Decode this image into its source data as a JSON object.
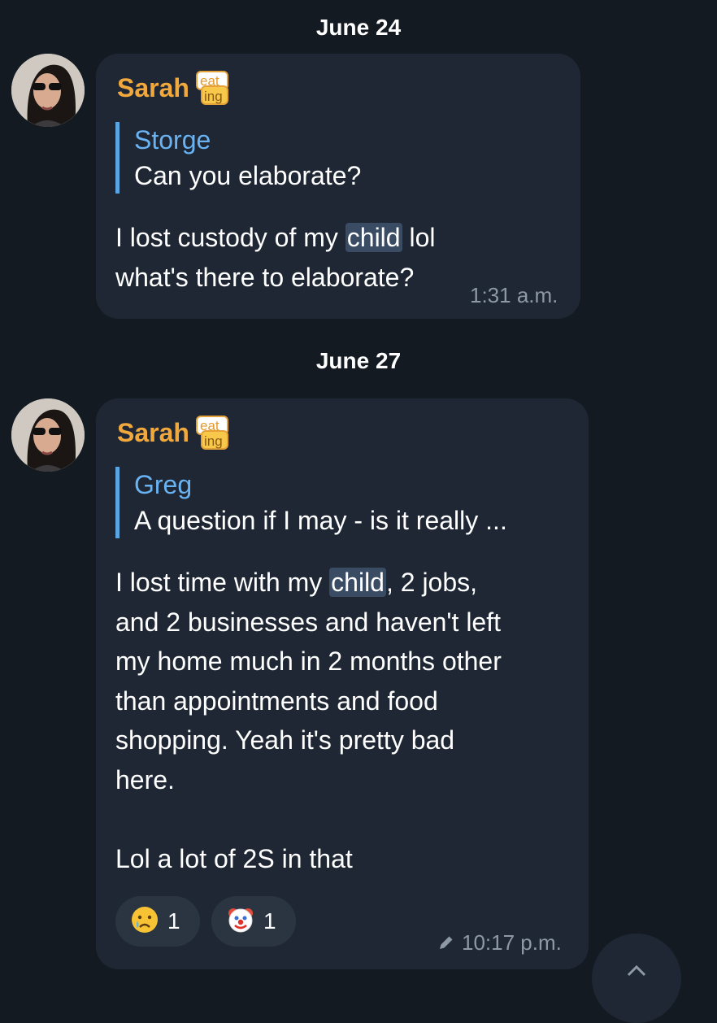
{
  "messages": [
    {
      "date": "June 24",
      "sender": "Sarah",
      "sticker_text": [
        "eat",
        "ing"
      ],
      "reply_to": {
        "name": "Storge",
        "text": "Can you elaborate?"
      },
      "body_lines": [
        {
          "pre": "I lost custody of my ",
          "hl": "child",
          "post": " lol"
        },
        {
          "pre": "what's there to elaborate?",
          "hl": "",
          "post": ""
        }
      ],
      "time": "1:31 a.m."
    },
    {
      "date": "June 27",
      "sender": "Sarah",
      "sticker_text": [
        "eat",
        "ing"
      ],
      "reply_to": {
        "name": "Greg",
        "text": "A question if I may - is it really ..."
      },
      "body_lines": [
        {
          "pre": "I lost time with my ",
          "hl": "child",
          "post": ", 2 jobs,"
        },
        {
          "pre": "and 2 businesses and haven't left",
          "hl": "",
          "post": ""
        },
        {
          "pre": "my home much in 2 months other",
          "hl": "",
          "post": ""
        },
        {
          "pre": "than appointments and food",
          "hl": "",
          "post": ""
        },
        {
          "pre": "shopping. Yeah it's pretty bad",
          "hl": "",
          "post": ""
        },
        {
          "pre": "here.",
          "hl": "",
          "post": ""
        },
        {
          "pre": "",
          "hl": "",
          "post": ""
        },
        {
          "pre": "Lol a lot of 2S in that",
          "hl": "",
          "post": ""
        }
      ],
      "reactions": [
        {
          "emoji": "crying-face",
          "count": "1"
        },
        {
          "emoji": "clown-face",
          "count": "1"
        }
      ],
      "edited_icon": "pencil-icon",
      "time": "10:17 p.m."
    }
  ],
  "colors": {
    "background": "#141a22",
    "bubble": "#1e2733",
    "sender_name": "#f1a93e",
    "reply_name": "#6ab3f3",
    "reply_bar": "#5aa5e0",
    "highlight": "#3a4c63",
    "timestamp": "#8e99a6"
  }
}
